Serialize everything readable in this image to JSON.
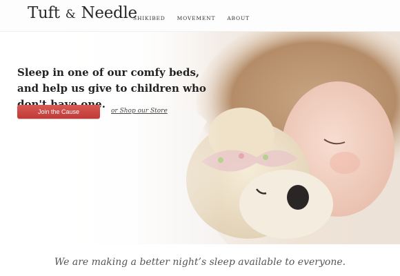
{
  "header": {
    "logo": {
      "part1": "Tuft",
      "amp": "&",
      "part2": "Needle"
    },
    "nav": [
      {
        "label": "SHIKIBED"
      },
      {
        "label": "MOVEMENT"
      },
      {
        "label": "ABOUT"
      }
    ]
  },
  "hero": {
    "headline": "Sleep in one of our comfy beds, and help us give to children who don't have one.",
    "cta_label": "Join the Cause",
    "secondary_link": "or Shop our Store",
    "image": "sleeping-child-with-teddy-bear"
  },
  "tagline": "We are making a better night’s sleep available to everyone.",
  "colors": {
    "cta": "#c9433f",
    "text": "#222222",
    "tagline": "#555555"
  }
}
